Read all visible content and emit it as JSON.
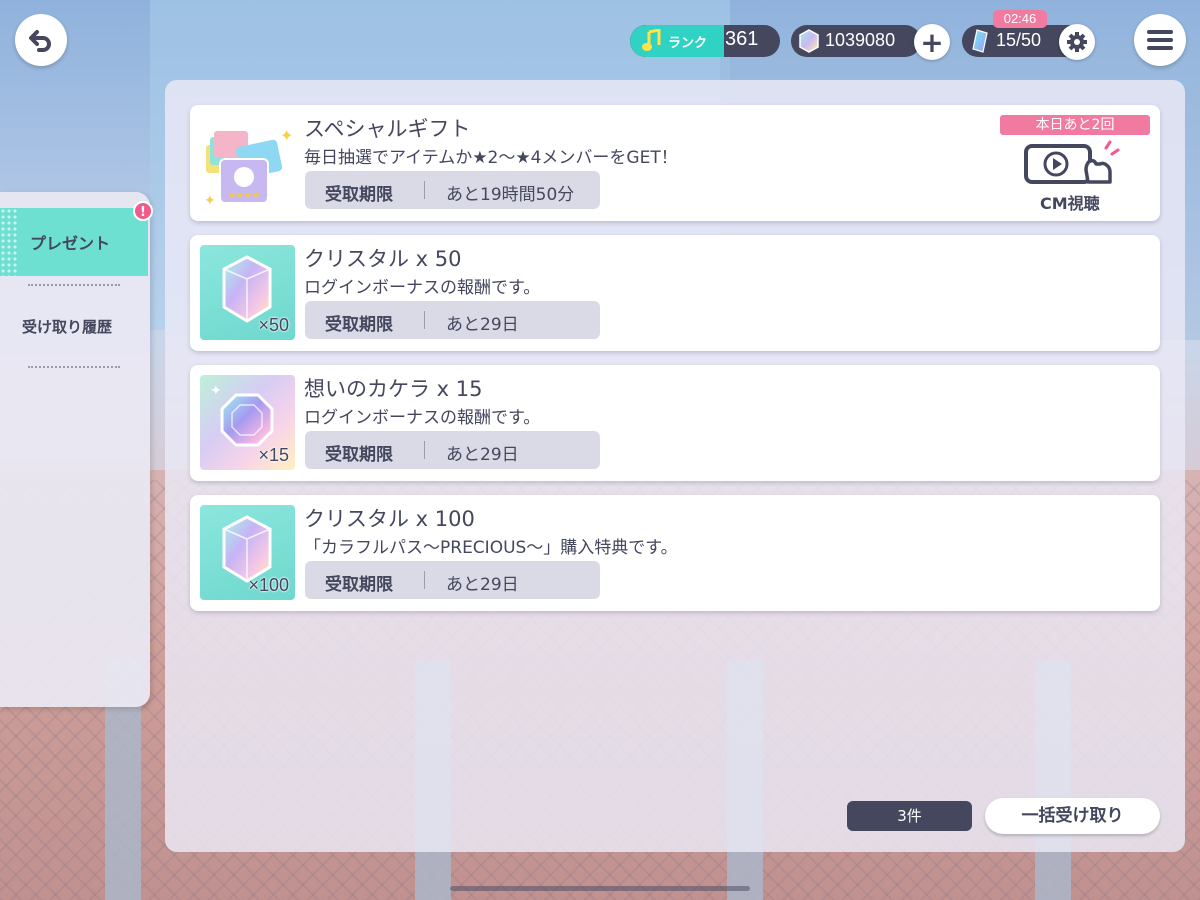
{
  "header": {
    "rank_label": "ランク",
    "rank_value": "361",
    "crystal_value": "1039080",
    "plus_label": "+",
    "energy_value": "15/50",
    "energy_timer": "02:46"
  },
  "sidebar": {
    "badge": "!",
    "items": [
      {
        "label": "プレゼント",
        "active": true
      },
      {
        "label": "受け取り履歴",
        "active": false
      }
    ]
  },
  "special_gift": {
    "title": "スペシャルギフト",
    "description": "毎日抽選でアイテムか★2〜★4メンバーをGET！",
    "deadline_label": "受取期限",
    "deadline_value": "あと19時間50分",
    "today_remaining": "本日あと2回",
    "cm_label": "CM視聴"
  },
  "presents": [
    {
      "title": "クリスタル x 50",
      "description": "ログインボーナスの報酬です。",
      "qty": "×50",
      "deadline_label": "受取期限",
      "deadline_value": "あと29日",
      "icon": "crystal-icon"
    },
    {
      "title": "想いのカケラ x 15",
      "description": "ログインボーナスの報酬です。",
      "qty": "×15",
      "deadline_label": "受取期限",
      "deadline_value": "あと29日",
      "icon": "fragment-icon"
    },
    {
      "title": "クリスタル x 100",
      "description": "「カラフルパス〜PRECIOUS〜」購入特典です。",
      "qty": "×100",
      "deadline_label": "受取期限",
      "deadline_value": "あと29日",
      "icon": "crystal-icon"
    }
  ],
  "footer": {
    "count": "3件",
    "claim_all": "一括受け取り"
  },
  "colors": {
    "accent_teal": "#6ee0d2",
    "dark_navy": "#44475e",
    "pink": "#f07aa0"
  }
}
